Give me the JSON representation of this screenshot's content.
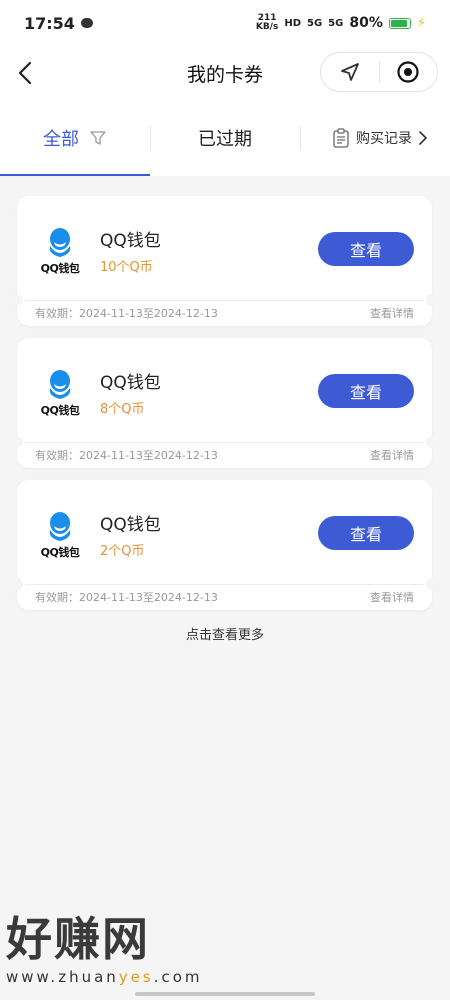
{
  "status_bar": {
    "time": "17:54",
    "net_speed_value": "211",
    "net_speed_unit": "KB/s",
    "hd_label": "HD",
    "signal1": "5G",
    "signal2": "5G",
    "battery": "80%"
  },
  "nav": {
    "title": "我的卡券"
  },
  "tabs": {
    "all": "全部",
    "expired": "已过期",
    "records": "购买记录"
  },
  "coupons": [
    {
      "logo_text": "QQ钱包",
      "name": "QQ钱包",
      "amount": "10个Q币",
      "button": "查看",
      "validity": "有效期：2024-11-13至2024-12-13",
      "details": "查看详情"
    },
    {
      "logo_text": "QQ钱包",
      "name": "QQ钱包",
      "amount": "8个Q币",
      "button": "查看",
      "validity": "有效期：2024-11-13至2024-12-13",
      "details": "查看详情"
    },
    {
      "logo_text": "QQ钱包",
      "name": "QQ钱包",
      "amount": "2个Q币",
      "button": "查看",
      "validity": "有效期：2024-11-13至2024-12-13",
      "details": "查看详情"
    }
  ],
  "load_more": "点击查看更多",
  "watermark": {
    "title": "好赚网",
    "url_prefix": "www.zhuan",
    "url_highlight": "yes",
    "url_suffix": ".com"
  },
  "colors": {
    "accent": "#3e5bd6",
    "amount": "#e29436",
    "battery": "#2db34a"
  },
  "icons": {
    "back": "back-arrow-icon",
    "location": "location-arrow-icon",
    "target": "target-icon",
    "filter": "filter-icon",
    "records": "clipboard-icon",
    "chevron": "chevron-right-icon",
    "logo": "qq-penguin-icon"
  }
}
